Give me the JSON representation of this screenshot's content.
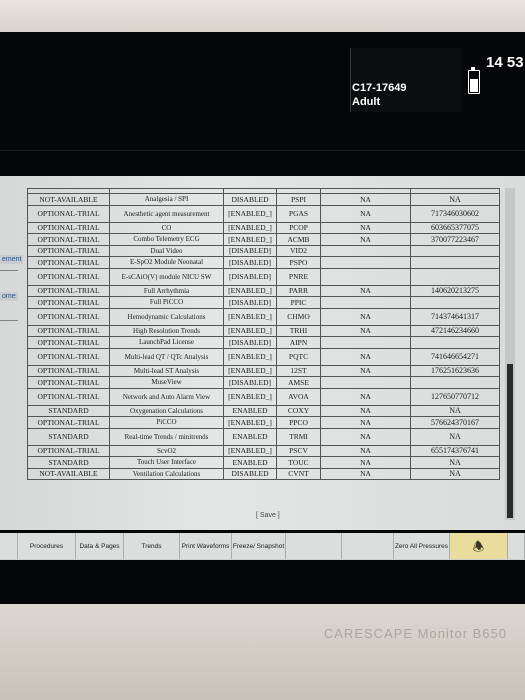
{
  "header": {
    "patient_id": "C17-17649",
    "patient_category": "Adult",
    "clock": "14 53"
  },
  "side_tabs": [
    "ement",
    "ome"
  ],
  "table": {
    "rows": [
      {
        "status": "NOT-AVAILABLE",
        "feature": "Analgesia / SPI",
        "state": "DISABLED",
        "code": "PSPI",
        "c5": "NA",
        "c6": "NA"
      },
      {
        "status": "OPTIONAL-TRIAL",
        "feature": "Anesthetic agent measurement",
        "state": "[ENABLED_]",
        "code": "PGAS",
        "c5": "NA",
        "c6": "717346030602"
      },
      {
        "status": "OPTIONAL-TRIAL",
        "feature": "CO",
        "state": "[ENABLED_]",
        "code": "PCOP",
        "c5": "NA",
        "c6": "603665377075"
      },
      {
        "status": "OPTIONAL-TRIAL",
        "feature": "Combo Telemetry ECG",
        "state": "[ENABLED_]",
        "code": "ACMB",
        "c5": "NA",
        "c6": "370077223467"
      },
      {
        "status": "OPTIONAL-TRIAL",
        "feature": "Dual Video",
        "state": "[DISABLED]",
        "code": "VID2",
        "c5": "",
        "c6": ""
      },
      {
        "status": "OPTIONAL-TRIAL",
        "feature": "E-SpO2 Module Neonatal",
        "state": "[DISABLED]",
        "code": "PSPO",
        "c5": "",
        "c6": ""
      },
      {
        "status": "OPTIONAL-TRIAL",
        "feature": "E-sCAiO(V) module NICU SW",
        "state": "[DISABLED]",
        "code": "PNRE",
        "c5": "",
        "c6": ""
      },
      {
        "status": "OPTIONAL-TRIAL",
        "feature": "Full Arrhythmia",
        "state": "[ENABLED_]",
        "code": "PARR",
        "c5": "NA",
        "c6": "140620213275"
      },
      {
        "status": "OPTIONAL-TRIAL",
        "feature": "Full PiCCO",
        "state": "[DISABLED]",
        "code": "PPIC",
        "c5": "",
        "c6": ""
      },
      {
        "status": "OPTIONAL-TRIAL",
        "feature": "Hemodynamic Calculations",
        "state": "[ENABLED_]",
        "code": "CHMO",
        "c5": "NA",
        "c6": "714374641317"
      },
      {
        "status": "OPTIONAL-TRIAL",
        "feature": "High Resolution Trends",
        "state": "[ENABLED_]",
        "code": "TRHI",
        "c5": "NA",
        "c6": "472146234660"
      },
      {
        "status": "OPTIONAL-TRIAL",
        "feature": "LaunchPad License",
        "state": "[DISABLED]",
        "code": "AIPN",
        "c5": "",
        "c6": ""
      },
      {
        "status": "OPTIONAL-TRIAL",
        "feature": "Multi-lead QT / QTc Analysis",
        "state": "[ENABLED_]",
        "code": "PQTC",
        "c5": "NA",
        "c6": "741646654271"
      },
      {
        "status": "OPTIONAL-TRIAL",
        "feature": "Multi-lead ST Analysis",
        "state": "[ENABLED_]",
        "code": "12ST",
        "c5": "NA",
        "c6": "176251623636"
      },
      {
        "status": "OPTIONAL-TRIAL",
        "feature": "MuseView",
        "state": "[DISABLED]",
        "code": "AMSE",
        "c5": "",
        "c6": ""
      },
      {
        "status": "OPTIONAL-TRIAL",
        "feature": "Network and Auto Alarm View",
        "state": "[ENABLED_]",
        "code": "AVOA",
        "c5": "NA",
        "c6": "127650770712"
      },
      {
        "status": "STANDARD",
        "feature": "Oxygenation Calculations",
        "state": "ENABLED",
        "code": "COXY",
        "c5": "NA",
        "c6": "NA"
      },
      {
        "status": "OPTIONAL-TRIAL",
        "feature": "PiCCO",
        "state": "[ENABLED_]",
        "code": "PPCO",
        "c5": "NA",
        "c6": "576624370167"
      },
      {
        "status": "STANDARD",
        "feature": "Real-time Trends / minitrends",
        "state": "ENABLED",
        "code": "TRMI",
        "c5": "NA",
        "c6": "NA"
      },
      {
        "status": "OPTIONAL-TRIAL",
        "feature": "ScvO2",
        "state": "[ENABLED_]",
        "code": "PSCV",
        "c5": "NA",
        "c6": "655174376741"
      },
      {
        "status": "STANDARD",
        "feature": "Touch User Interface",
        "state": "ENABLED",
        "code": "TOUC",
        "c5": "NA",
        "c6": "NA"
      },
      {
        "status": "NOT-AVAILABLE",
        "feature": "Ventilation Calculations",
        "state": "DISABLED",
        "code": "CVNT",
        "c5": "NA",
        "c6": "NA"
      }
    ],
    "save_label": "[ Save ]"
  },
  "menu": {
    "items": [
      "Procedures",
      "Data & Pages",
      "Trends",
      "Print Waveforms",
      "Freeze/ Snapshot",
      "Zero All Pressures"
    ]
  },
  "brand": "CARESCAPE Monitor B650"
}
